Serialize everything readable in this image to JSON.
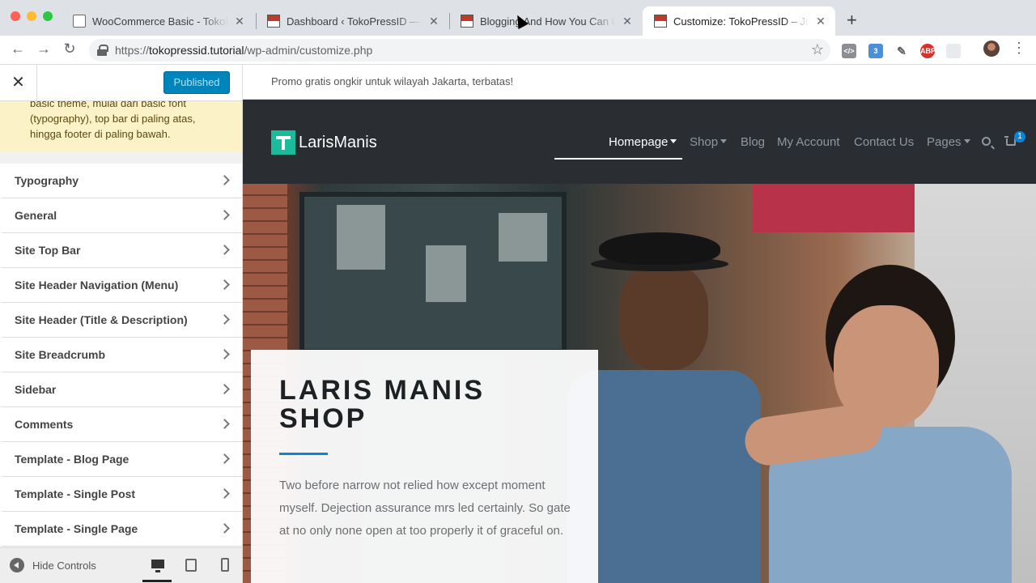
{
  "browser": {
    "tabs": [
      {
        "title": "WooCommerce Basic - TokoPress"
      },
      {
        "title": "Dashboard ‹ TokoPressID — WordPress"
      },
      {
        "title": "Blogging And How You Can Get"
      },
      {
        "title": "Customize: TokoPressID – Just"
      }
    ],
    "url_scheme": "https://",
    "url_host": "tokopressid.tutorial",
    "url_path": "/wp-admin/customize.php"
  },
  "sidebar": {
    "publish_label": "Published",
    "notice_text": "basic theme, mulai dari basic font (typography), top bar di paling atas, hingga footer di paling bawah.",
    "panels": [
      {
        "label": "Typography"
      },
      {
        "label": "General"
      },
      {
        "label": "Site Top Bar"
      },
      {
        "label": "Site Header Navigation (Menu)"
      },
      {
        "label": "Site Header (Title & Description)"
      },
      {
        "label": "Site Breadcrumb"
      },
      {
        "label": "Sidebar"
      },
      {
        "label": "Comments"
      },
      {
        "label": "Template - Blog Page"
      },
      {
        "label": "Template - Single Post"
      },
      {
        "label": "Template - Single Page"
      }
    ],
    "hide_controls_label": "Hide Controls"
  },
  "site": {
    "topbar_text": "Promo gratis ongkir untuk wilayah Jakarta, terbatas!",
    "name": "LarisManis",
    "nav": {
      "homepage": "Homepage",
      "shop": "Shop",
      "blog": "Blog",
      "account": "My Account",
      "contact": "Contact Us",
      "pages": "Pages"
    },
    "cart_count": "1",
    "accent_color": "#0a84d6",
    "hero": {
      "title": "LARIS MANIS SHOP",
      "text": "Two before narrow not relied how except moment myself. Dejection assurance mrs led certainly. So gate at no only none open at too properly it of graceful on."
    }
  },
  "icons": [
    "close-icon",
    "chevron-right-icon",
    "search-icon",
    "cart-icon",
    "desktop-icon",
    "tablet-icon",
    "mobile-icon",
    "lock-icon",
    "star-icon"
  ]
}
